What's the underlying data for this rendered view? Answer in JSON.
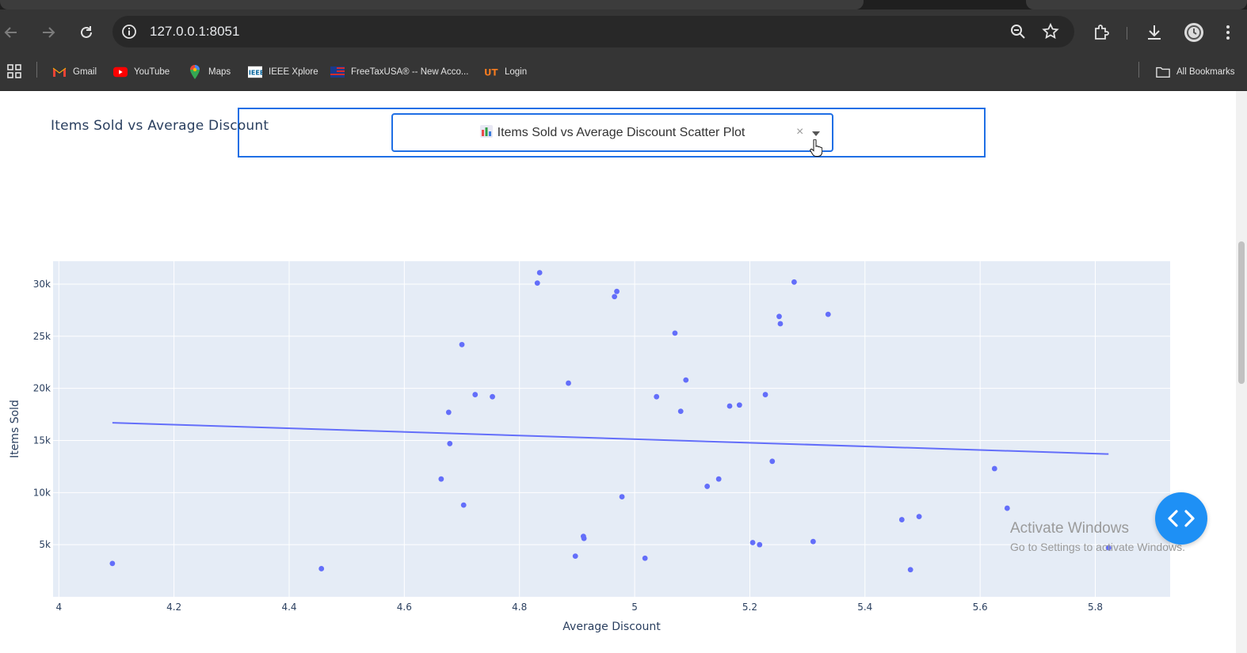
{
  "browser": {
    "url": "127.0.0.1:8051",
    "bookmarks": [
      {
        "label": "Gmail",
        "icon": "gmail-icon"
      },
      {
        "label": "YouTube",
        "icon": "youtube-icon"
      },
      {
        "label": "Maps",
        "icon": "maps-icon"
      },
      {
        "label": "IEEE Xplore",
        "icon": "ieee-icon"
      },
      {
        "label": "FreeTaxUSA® -- New Acco...",
        "icon": "freetaxusa-icon"
      },
      {
        "label": "Login",
        "icon": "ut-login-icon"
      }
    ],
    "all_bookmarks": "All Bookmarks"
  },
  "dropdown": {
    "selected": "Items Sold vs Average Discount Scatter Plot",
    "clear_symbol": "×"
  },
  "chart_data": {
    "type": "scatter",
    "title": "Items Sold vs Average Discount",
    "xlabel": "Average Discount",
    "ylabel": "Items Sold",
    "xlim": [
      3.99,
      5.93
    ],
    "ylim": [
      0,
      32200
    ],
    "xticks": [
      4,
      4.2,
      4.4,
      4.6,
      4.8,
      5,
      5.2,
      5.4,
      5.6,
      5.8
    ],
    "xtick_labels": [
      "4",
      "4.2",
      "4.4",
      "4.6",
      "4.8",
      "5",
      "5.2",
      "5.4",
      "5.6",
      "5.8"
    ],
    "yticks": [
      5000,
      10000,
      15000,
      20000,
      25000,
      30000
    ],
    "ytick_labels": [
      "5k",
      "10k",
      "15k",
      "20k",
      "25k",
      "30k"
    ],
    "grid": true,
    "marker_color": "#636efa",
    "points": [
      {
        "x": 4.093,
        "y": 3200
      },
      {
        "x": 4.456,
        "y": 2700
      },
      {
        "x": 4.664,
        "y": 11300
      },
      {
        "x": 4.677,
        "y": 17700
      },
      {
        "x": 4.679,
        "y": 14700
      },
      {
        "x": 4.7,
        "y": 24200
      },
      {
        "x": 4.703,
        "y": 8800
      },
      {
        "x": 4.723,
        "y": 19400
      },
      {
        "x": 4.753,
        "y": 19200
      },
      {
        "x": 4.831,
        "y": 30100
      },
      {
        "x": 4.835,
        "y": 31100
      },
      {
        "x": 4.885,
        "y": 20500
      },
      {
        "x": 4.897,
        "y": 3900
      },
      {
        "x": 4.911,
        "y": 5800
      },
      {
        "x": 4.912,
        "y": 5600
      },
      {
        "x": 4.965,
        "y": 28800
      },
      {
        "x": 4.969,
        "y": 29300
      },
      {
        "x": 4.978,
        "y": 9600
      },
      {
        "x": 5.018,
        "y": 3700
      },
      {
        "x": 5.038,
        "y": 19200
      },
      {
        "x": 5.07,
        "y": 25300
      },
      {
        "x": 5.08,
        "y": 17800
      },
      {
        "x": 5.089,
        "y": 20800
      },
      {
        "x": 5.126,
        "y": 10600
      },
      {
        "x": 5.146,
        "y": 11300
      },
      {
        "x": 5.165,
        "y": 18300
      },
      {
        "x": 5.182,
        "y": 18400
      },
      {
        "x": 5.205,
        "y": 5200
      },
      {
        "x": 5.217,
        "y": 5000
      },
      {
        "x": 5.227,
        "y": 19400
      },
      {
        "x": 5.239,
        "y": 13000
      },
      {
        "x": 5.251,
        "y": 26900
      },
      {
        "x": 5.253,
        "y": 26200
      },
      {
        "x": 5.277,
        "y": 30200
      },
      {
        "x": 5.31,
        "y": 5300
      },
      {
        "x": 5.336,
        "y": 27100
      },
      {
        "x": 5.464,
        "y": 7400
      },
      {
        "x": 5.479,
        "y": 2600
      },
      {
        "x": 5.494,
        "y": 7700
      },
      {
        "x": 5.625,
        "y": 12300
      },
      {
        "x": 5.647,
        "y": 8500
      },
      {
        "x": 5.823,
        "y": 4700
      }
    ],
    "trendline": {
      "x": [
        4.093,
        5.823
      ],
      "y": [
        16700,
        13700
      ]
    }
  },
  "overlay": {
    "activate_line1": "Activate Windows",
    "activate_line2": "Go to Settings to activate Windows."
  }
}
